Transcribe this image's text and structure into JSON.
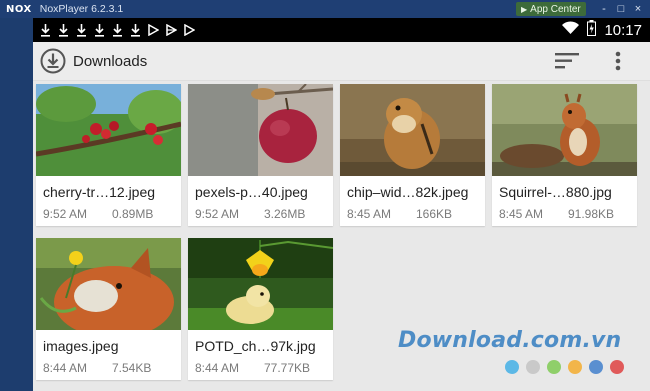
{
  "window": {
    "logo": "NOX",
    "title": "NoxPlayer 6.2.3.1",
    "app_center": "App Center",
    "controls": [
      "-",
      "□",
      "×"
    ]
  },
  "statusbar": {
    "time": "10:17",
    "notification_icons": [
      "download-icon",
      "download-icon",
      "download-icon",
      "download-icon",
      "download-icon",
      "download-icon",
      "play-store-icon",
      "play-store-icon",
      "play-store-icon"
    ]
  },
  "actionbar": {
    "title": "Downloads"
  },
  "files": [
    {
      "name": "cherry-tr…12.jpeg",
      "time": "9:52 AM",
      "size": "0.89MB",
      "thumb": "cherry"
    },
    {
      "name": "pexels-p…40.jpeg",
      "time": "9:52 AM",
      "size": "3.26MB",
      "thumb": "apple"
    },
    {
      "name": "chip–wid…82k.jpeg",
      "time": "8:45 AM",
      "size": "166KB",
      "thumb": "chipmunk"
    },
    {
      "name": "Squirrel-…880.jpg",
      "time": "8:45 AM",
      "size": "91.98KB",
      "thumb": "squirrel"
    },
    {
      "name": "images.jpeg",
      "time": "8:44 AM",
      "size": "7.54KB",
      "thumb": "fox"
    },
    {
      "name": "POTD_ch…97k.jpg",
      "time": "8:44 AM",
      "size": "77.77KB",
      "thumb": "chick"
    }
  ],
  "watermark": {
    "text": "Download.com.vn",
    "dot_colors": [
      "#5cb8e6",
      "#c9c9c9",
      "#8fcf6a",
      "#f2b54a",
      "#5a8fd0",
      "#e05a5a"
    ]
  }
}
